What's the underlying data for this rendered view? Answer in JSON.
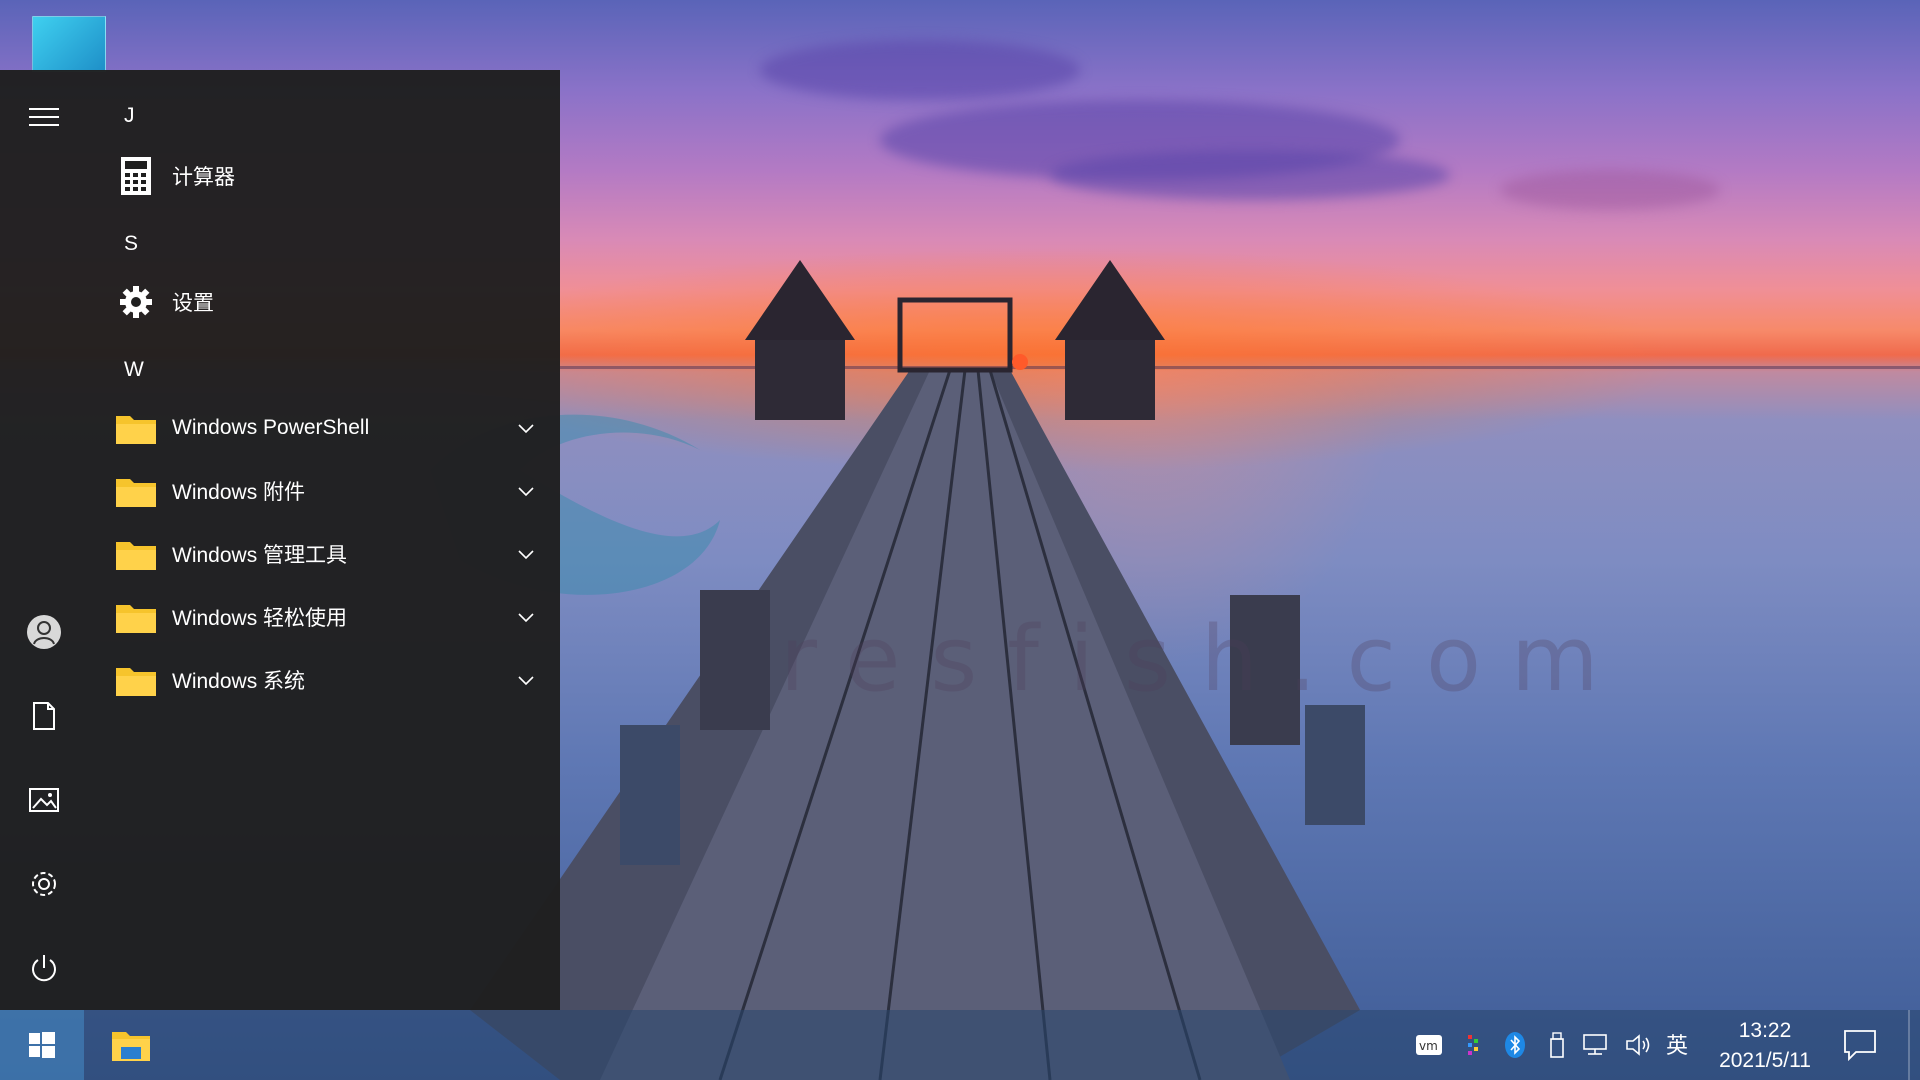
{
  "start_menu": {
    "sections": [
      {
        "letter": "J",
        "apps": [
          {
            "label": "计算器",
            "icon": "calculator-icon"
          }
        ]
      },
      {
        "letter": "S",
        "apps": [
          {
            "label": "设置",
            "icon": "gear-icon"
          }
        ]
      },
      {
        "letter": "W",
        "apps": [
          {
            "label": "Windows PowerShell",
            "icon": "folder-icon",
            "expandable": true
          },
          {
            "label": "Windows 附件",
            "icon": "folder-icon",
            "expandable": true
          },
          {
            "label": "Windows 管理工具",
            "icon": "folder-icon",
            "expandable": true
          },
          {
            "label": "Windows 轻松使用",
            "icon": "folder-icon",
            "expandable": true
          },
          {
            "label": "Windows 系统",
            "icon": "folder-icon",
            "expandable": true
          }
        ]
      }
    ],
    "rail_icons": [
      "hamburger-menu-icon",
      "user-account-icon",
      "documents-icon",
      "pictures-icon",
      "settings-icon",
      "power-icon"
    ]
  },
  "taskbar": {
    "start_icon": "windows-logo-icon",
    "pinned": [
      "file-explorer-icon"
    ],
    "tray_icons": [
      "vmware-tools-icon",
      "colorful-app-icon",
      "bluetooth-icon",
      "usb-drive-icon",
      "network-icon",
      "volume-icon"
    ],
    "ime": "英",
    "time": "13:22",
    "date": "2021/5/11",
    "notification_icon": "action-center-icon"
  },
  "watermark": {
    "brand": "resfish.com"
  },
  "colors": {
    "menu_bg": "#1f1f1f",
    "folder": "#f6c42c",
    "taskbar_start_bg": "#468cc8"
  }
}
